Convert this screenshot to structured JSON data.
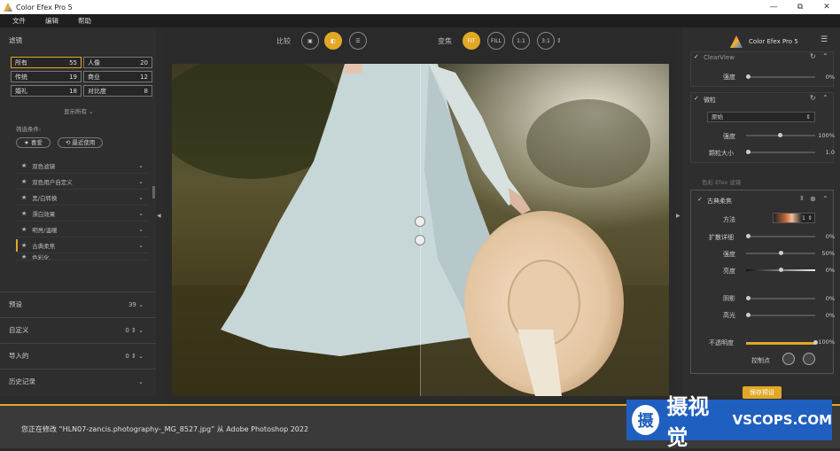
{
  "window": {
    "title": "Color Efex Pro 5",
    "min": "—",
    "max": "⧉",
    "close": "✕"
  },
  "menu": [
    "文件",
    "编辑",
    "帮助"
  ],
  "left": {
    "filters_label": "滤镜",
    "filters_count": "55",
    "categories": [
      {
        "label": "所有",
        "count": "55"
      },
      {
        "label": "人像",
        "count": "20"
      },
      {
        "label": "传统",
        "count": "19"
      },
      {
        "label": "商业",
        "count": "12"
      },
      {
        "label": "婚礼",
        "count": "18"
      },
      {
        "label": "对比度",
        "count": "8"
      }
    ],
    "show_all": "显示所有",
    "filter_conditions": "筛选条件:",
    "pill_favorites": "★ 喜爱",
    "pill_recent": "⟲ 最近使用",
    "filters": [
      "双色滤镜",
      "双色用户自定义",
      "黑/白转换",
      "漂白效果",
      "明亮/温暖",
      "古典柔焦",
      "色彩化"
    ],
    "presets_label": "预设",
    "presets_count": "39",
    "custom_label": "自定义",
    "custom_count": "0",
    "imported_label": "导入的",
    "imported_count": "0",
    "history_label": "历史记录"
  },
  "toolbar": {
    "compare_label": "比较",
    "zoom_label": "变焦",
    "fit": "FIT",
    "fill": "FILL",
    "one": "1:1",
    "three": "3:1"
  },
  "right": {
    "brand": "Color Efex Pro 5",
    "clearview_label": "ClearView",
    "strength_label": "强度",
    "clearview_strength": "0%",
    "grain_label": "微粒",
    "grain_select": "原始",
    "grain_strength_label": "强度",
    "grain_strength": "100%",
    "grain_size_label": "颗粒大小",
    "grain_size": "1.0",
    "stack_header": "色彩 Efex 滤镜",
    "softfocus_label": "古典柔焦",
    "method_label": "方法",
    "method_value": "1",
    "diffuse_label": "扩散详细",
    "diffuse_value": "0%",
    "sf_strength_label": "强度",
    "sf_strength_value": "50%",
    "brightness_label": "亮度",
    "brightness_value": "0%",
    "shadows_label": "阴影",
    "shadows_value": "0%",
    "highlights_label": "高光",
    "highlights_value": "0%",
    "opacity_label": "不透明度",
    "opacity_value": "100%",
    "ctrl_label": "控制点",
    "save_preset": "保存预设"
  },
  "status": {
    "message": "您正在修改 “HLN07-zancis.photography-_MG_8527.jpg” 从 Adobe Photoshop 2022"
  },
  "watermark": {
    "logo": "摄",
    "cn": "摄视觉",
    "en": "VSCOPS.COM"
  }
}
